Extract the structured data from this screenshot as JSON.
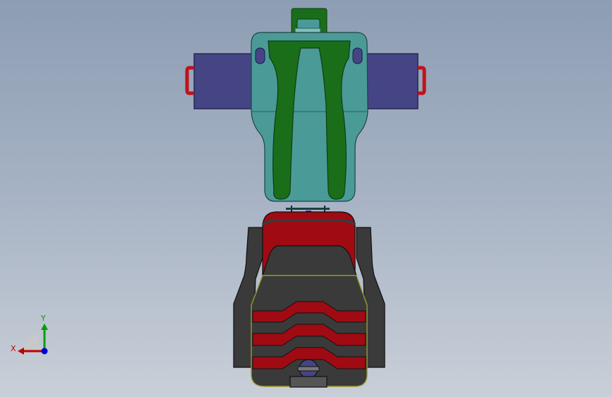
{
  "viewport": {
    "background_top": "#8d9db3",
    "background_bottom": "#c9cfd8"
  },
  "triad": {
    "x_label": "X",
    "y_label": "Y",
    "x_color": "#c00000",
    "y_color": "#00a000",
    "z_color": "#0000d0"
  },
  "colors": {
    "shell_teal": "#4a9a98",
    "strap_green": "#1a6e1a",
    "side_blue": "#454585",
    "handle_red": "#c0121a",
    "base_dark": "#3a3a3a",
    "base_red": "#a00a12",
    "base_grey": "#555555"
  }
}
